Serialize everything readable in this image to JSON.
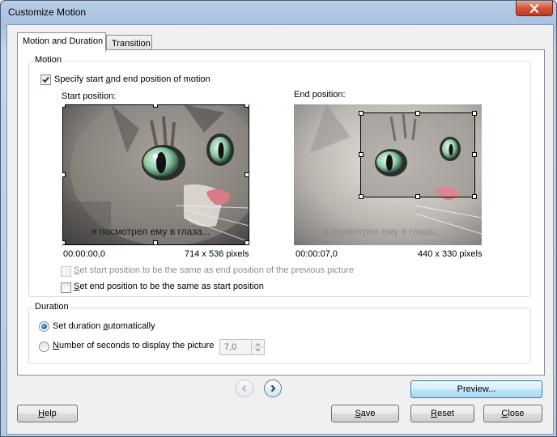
{
  "window": {
    "title": "Customize Motion"
  },
  "tabs": [
    {
      "label": "Motion and Duration"
    },
    {
      "label": "Transition"
    }
  ],
  "motion": {
    "legend": "Motion",
    "specify_label_pre": "Specify start ",
    "specify_label_ul": "a",
    "specify_label_post": "nd end position of motion",
    "start": {
      "label": "Start position:",
      "time": "00:00:00,0",
      "size": "714 x 536 pixels",
      "caption": "я посмотрел ему в глаза..."
    },
    "end": {
      "label": "End position:",
      "time": "00:00:07,0",
      "size": "440 x 330 pixels",
      "caption": "я посмотрел ему в глаза..."
    },
    "same_as_prev_ul": "S",
    "same_as_prev_post": "et start position to be the same as end position of the previous picture",
    "end_same_ul": "S",
    "end_same_post": "et end position to be the same as start position"
  },
  "duration": {
    "legend": "Duration",
    "auto_pre": "Set duration ",
    "auto_ul": "a",
    "auto_post": "utomatically",
    "seconds_ul": "N",
    "seconds_post": "umber of seconds to display the picture",
    "seconds_value": "7,0"
  },
  "buttons": {
    "preview": "Preview...",
    "help_ul": "H",
    "help_post": "elp",
    "save_ul": "S",
    "save_post": "ave",
    "reset_ul": "R",
    "reset_post": "eset",
    "close_ul": "C",
    "close_post": "lose"
  },
  "colors": {
    "accent": "#3c7fb1",
    "close_button": "#c0391d",
    "crop_frame": "#000000"
  }
}
